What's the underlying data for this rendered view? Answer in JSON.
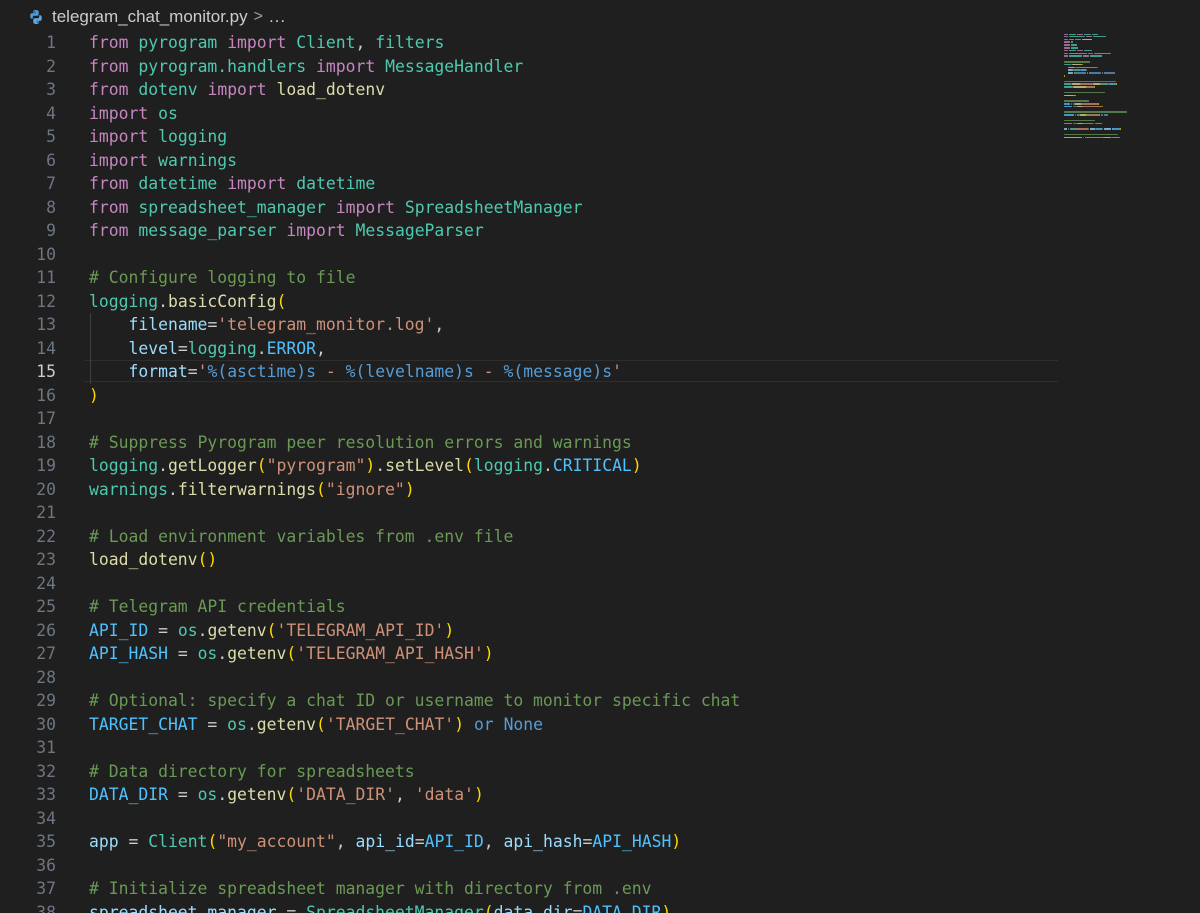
{
  "breadcrumb": {
    "file_icon": "python-icon",
    "file_name": "telegram_chat_monitor.py",
    "separator": ">",
    "more": "..."
  },
  "editor": {
    "active_line": 15,
    "lines": [
      {
        "n": "1",
        "tokens": [
          [
            "kw",
            "from"
          ],
          [
            "pl",
            " "
          ],
          [
            "mo",
            "pyrogram"
          ],
          [
            "pl",
            " "
          ],
          [
            "kw",
            "import"
          ],
          [
            "pl",
            " "
          ],
          [
            "ty",
            "Client"
          ],
          [
            "pl",
            ", "
          ],
          [
            "mo",
            "filters"
          ]
        ]
      },
      {
        "n": "2",
        "tokens": [
          [
            "kw",
            "from"
          ],
          [
            "pl",
            " "
          ],
          [
            "mo",
            "pyrogram.handlers"
          ],
          [
            "pl",
            " "
          ],
          [
            "kw",
            "import"
          ],
          [
            "pl",
            " "
          ],
          [
            "ty",
            "MessageHandler"
          ]
        ]
      },
      {
        "n": "3",
        "tokens": [
          [
            "kw",
            "from"
          ],
          [
            "pl",
            " "
          ],
          [
            "mo",
            "dotenv"
          ],
          [
            "pl",
            " "
          ],
          [
            "kw",
            "import"
          ],
          [
            "pl",
            " "
          ],
          [
            "fn",
            "load_dotenv"
          ]
        ]
      },
      {
        "n": "4",
        "tokens": [
          [
            "kw",
            "import"
          ],
          [
            "pl",
            " "
          ],
          [
            "mo",
            "os"
          ]
        ]
      },
      {
        "n": "5",
        "tokens": [
          [
            "kw",
            "import"
          ],
          [
            "pl",
            " "
          ],
          [
            "mo",
            "logging"
          ]
        ]
      },
      {
        "n": "6",
        "tokens": [
          [
            "kw",
            "import"
          ],
          [
            "pl",
            " "
          ],
          [
            "mo",
            "warnings"
          ]
        ]
      },
      {
        "n": "7",
        "tokens": [
          [
            "kw",
            "from"
          ],
          [
            "pl",
            " "
          ],
          [
            "mo",
            "datetime"
          ],
          [
            "pl",
            " "
          ],
          [
            "kw",
            "import"
          ],
          [
            "pl",
            " "
          ],
          [
            "ty",
            "datetime"
          ]
        ]
      },
      {
        "n": "8",
        "tokens": [
          [
            "kw",
            "from"
          ],
          [
            "pl",
            " "
          ],
          [
            "mo",
            "spreadsheet_manager"
          ],
          [
            "pl",
            " "
          ],
          [
            "kw",
            "import"
          ],
          [
            "pl",
            " "
          ],
          [
            "ty",
            "SpreadsheetManager"
          ]
        ]
      },
      {
        "n": "9",
        "tokens": [
          [
            "kw",
            "from"
          ],
          [
            "pl",
            " "
          ],
          [
            "mo",
            "message_parser"
          ],
          [
            "pl",
            " "
          ],
          [
            "kw",
            "import"
          ],
          [
            "pl",
            " "
          ],
          [
            "ty",
            "MessageParser"
          ]
        ]
      },
      {
        "n": "10",
        "tokens": []
      },
      {
        "n": "11",
        "tokens": [
          [
            "cm",
            "# Configure logging to file"
          ]
        ]
      },
      {
        "n": "12",
        "tokens": [
          [
            "mo",
            "logging"
          ],
          [
            "pl",
            "."
          ],
          [
            "fn",
            "basicConfig"
          ],
          [
            "b1",
            "("
          ]
        ]
      },
      {
        "n": "13",
        "tokens": [
          [
            "pl",
            "    "
          ],
          [
            "vr",
            "filename"
          ],
          [
            "pl",
            "="
          ],
          [
            "st",
            "'telegram_monitor.log'"
          ],
          [
            "pl",
            ","
          ]
        ]
      },
      {
        "n": "14",
        "tokens": [
          [
            "pl",
            "    "
          ],
          [
            "vr",
            "level"
          ],
          [
            "pl",
            "="
          ],
          [
            "mo",
            "logging"
          ],
          [
            "pl",
            "."
          ],
          [
            "cn",
            "ERROR"
          ],
          [
            "pl",
            ","
          ]
        ]
      },
      {
        "n": "15",
        "tokens": [
          [
            "pl",
            "    "
          ],
          [
            "vr",
            "format"
          ],
          [
            "pl",
            "="
          ],
          [
            "st",
            "'"
          ],
          [
            "bl",
            "%(asctime)s"
          ],
          [
            "st",
            " - "
          ],
          [
            "bl",
            "%(levelname)s"
          ],
          [
            "st",
            " - "
          ],
          [
            "bl",
            "%(message)s"
          ],
          [
            "st",
            "'"
          ]
        ]
      },
      {
        "n": "16",
        "tokens": [
          [
            "b1",
            ")"
          ]
        ]
      },
      {
        "n": "17",
        "tokens": []
      },
      {
        "n": "18",
        "tokens": [
          [
            "cm",
            "# Suppress Pyrogram peer resolution errors and warnings"
          ]
        ]
      },
      {
        "n": "19",
        "tokens": [
          [
            "mo",
            "logging"
          ],
          [
            "pl",
            "."
          ],
          [
            "fn",
            "getLogger"
          ],
          [
            "b1",
            "("
          ],
          [
            "st",
            "\"pyrogram\""
          ],
          [
            "b1",
            ")"
          ],
          [
            "pl",
            "."
          ],
          [
            "fn",
            "setLevel"
          ],
          [
            "b1",
            "("
          ],
          [
            "mo",
            "logging"
          ],
          [
            "pl",
            "."
          ],
          [
            "cn",
            "CRITICAL"
          ],
          [
            "b1",
            ")"
          ]
        ]
      },
      {
        "n": "20",
        "tokens": [
          [
            "mo",
            "warnings"
          ],
          [
            "pl",
            "."
          ],
          [
            "fn",
            "filterwarnings"
          ],
          [
            "b1",
            "("
          ],
          [
            "st",
            "\"ignore\""
          ],
          [
            "b1",
            ")"
          ]
        ]
      },
      {
        "n": "21",
        "tokens": []
      },
      {
        "n": "22",
        "tokens": [
          [
            "cm",
            "# Load environment variables from .env file"
          ]
        ]
      },
      {
        "n": "23",
        "tokens": [
          [
            "fn",
            "load_dotenv"
          ],
          [
            "b1",
            "()"
          ]
        ]
      },
      {
        "n": "24",
        "tokens": []
      },
      {
        "n": "25",
        "tokens": [
          [
            "cm",
            "# Telegram API credentials"
          ]
        ]
      },
      {
        "n": "26",
        "tokens": [
          [
            "cn",
            "API_ID"
          ],
          [
            "pl",
            " = "
          ],
          [
            "mo",
            "os"
          ],
          [
            "pl",
            "."
          ],
          [
            "fn",
            "getenv"
          ],
          [
            "b1",
            "("
          ],
          [
            "st",
            "'TELEGRAM_API_ID'"
          ],
          [
            "b1",
            ")"
          ]
        ]
      },
      {
        "n": "27",
        "tokens": [
          [
            "cn",
            "API_HASH"
          ],
          [
            "pl",
            " = "
          ],
          [
            "mo",
            "os"
          ],
          [
            "pl",
            "."
          ],
          [
            "fn",
            "getenv"
          ],
          [
            "b1",
            "("
          ],
          [
            "st",
            "'TELEGRAM_API_HASH'"
          ],
          [
            "b1",
            ")"
          ]
        ]
      },
      {
        "n": "28",
        "tokens": []
      },
      {
        "n": "29",
        "tokens": [
          [
            "cm",
            "# Optional: specify a chat ID or username to monitor specific chat"
          ]
        ]
      },
      {
        "n": "30",
        "tokens": [
          [
            "cn",
            "TARGET_CHAT"
          ],
          [
            "pl",
            " = "
          ],
          [
            "mo",
            "os"
          ],
          [
            "pl",
            "."
          ],
          [
            "fn",
            "getenv"
          ],
          [
            "b1",
            "("
          ],
          [
            "st",
            "'TARGET_CHAT'"
          ],
          [
            "b1",
            ")"
          ],
          [
            "pl",
            " "
          ],
          [
            "bl",
            "or"
          ],
          [
            "pl",
            " "
          ],
          [
            "bl",
            "None"
          ]
        ]
      },
      {
        "n": "31",
        "tokens": []
      },
      {
        "n": "32",
        "tokens": [
          [
            "cm",
            "# Data directory for spreadsheets"
          ]
        ]
      },
      {
        "n": "33",
        "tokens": [
          [
            "cn",
            "DATA_DIR"
          ],
          [
            "pl",
            " = "
          ],
          [
            "mo",
            "os"
          ],
          [
            "pl",
            "."
          ],
          [
            "fn",
            "getenv"
          ],
          [
            "b1",
            "("
          ],
          [
            "st",
            "'DATA_DIR'"
          ],
          [
            "pl",
            ", "
          ],
          [
            "st",
            "'data'"
          ],
          [
            "b1",
            ")"
          ]
        ]
      },
      {
        "n": "34",
        "tokens": []
      },
      {
        "n": "35",
        "tokens": [
          [
            "vr",
            "app"
          ],
          [
            "pl",
            " = "
          ],
          [
            "ty",
            "Client"
          ],
          [
            "b1",
            "("
          ],
          [
            "st",
            "\"my_account\""
          ],
          [
            "pl",
            ", "
          ],
          [
            "vr",
            "api_id"
          ],
          [
            "pl",
            "="
          ],
          [
            "cn",
            "API_ID"
          ],
          [
            "pl",
            ", "
          ],
          [
            "vr",
            "api_hash"
          ],
          [
            "pl",
            "="
          ],
          [
            "cn",
            "API_HASH"
          ],
          [
            "b1",
            ")"
          ]
        ]
      },
      {
        "n": "36",
        "tokens": []
      },
      {
        "n": "37",
        "tokens": [
          [
            "cm",
            "# Initialize spreadsheet manager with directory from .env"
          ]
        ]
      },
      {
        "n": "38",
        "tokens": [
          [
            "vr",
            "spreadsheet_manager"
          ],
          [
            "pl",
            " = "
          ],
          [
            "ty",
            "SpreadsheetManager"
          ],
          [
            "b1",
            "("
          ],
          [
            "vr",
            "data_dir"
          ],
          [
            "pl",
            "="
          ],
          [
            "cn",
            "DATA_DIR"
          ],
          [
            "b1",
            ")"
          ]
        ]
      }
    ]
  }
}
